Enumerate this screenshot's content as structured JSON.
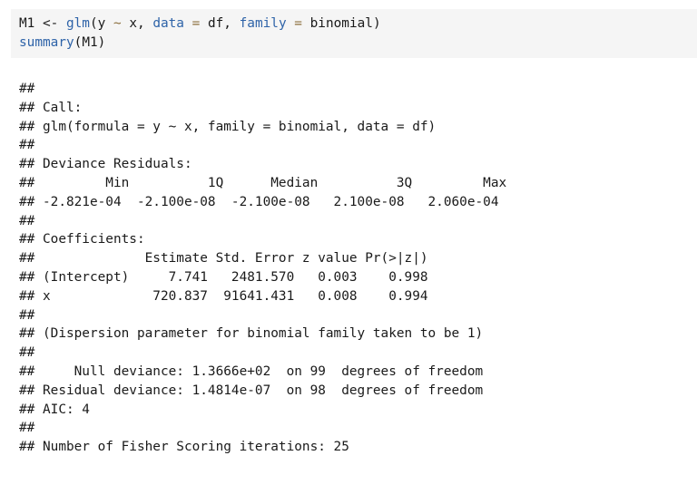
{
  "code": {
    "line1": [
      {
        "t": "M1 <- ",
        "k": "default"
      },
      {
        "t": "glm",
        "k": "fn"
      },
      {
        "t": "(y ",
        "k": "default"
      },
      {
        "t": "~",
        "k": "op"
      },
      {
        "t": " x, ",
        "k": "default"
      },
      {
        "t": "data",
        "k": "arg"
      },
      {
        "t": " ",
        "k": "default"
      },
      {
        "t": "=",
        "k": "op"
      },
      {
        "t": " df, ",
        "k": "default"
      },
      {
        "t": "family",
        "k": "arg"
      },
      {
        "t": " ",
        "k": "default"
      },
      {
        "t": "=",
        "k": "op"
      },
      {
        "t": " binomial)",
        "k": "default"
      }
    ],
    "line2": [
      {
        "t": "summary",
        "k": "fn"
      },
      {
        "t": "(M1)",
        "k": "default"
      }
    ]
  },
  "output_lines": [
    "##",
    "## Call:",
    "## glm(formula = y ~ x, family = binomial, data = df)",
    "##",
    "## Deviance Residuals:",
    "##         Min          1Q      Median          3Q         Max",
    "## -2.821e-04  -2.100e-08  -2.100e-08   2.100e-08   2.060e-04",
    "##",
    "## Coefficients:",
    "##              Estimate Std. Error z value Pr(>|z|)",
    "## (Intercept)     7.741   2481.570   0.003    0.998",
    "## x             720.837  91641.431   0.008    0.994",
    "##",
    "## (Dispersion parameter for binomial family taken to be 1)",
    "##",
    "##     Null deviance: 1.3666e+02  on 99  degrees of freedom",
    "## Residual deviance: 1.4814e-07  on 98  degrees of freedom",
    "## AIC: 4",
    "##",
    "## Number of Fisher Scoring iterations: 25"
  ]
}
